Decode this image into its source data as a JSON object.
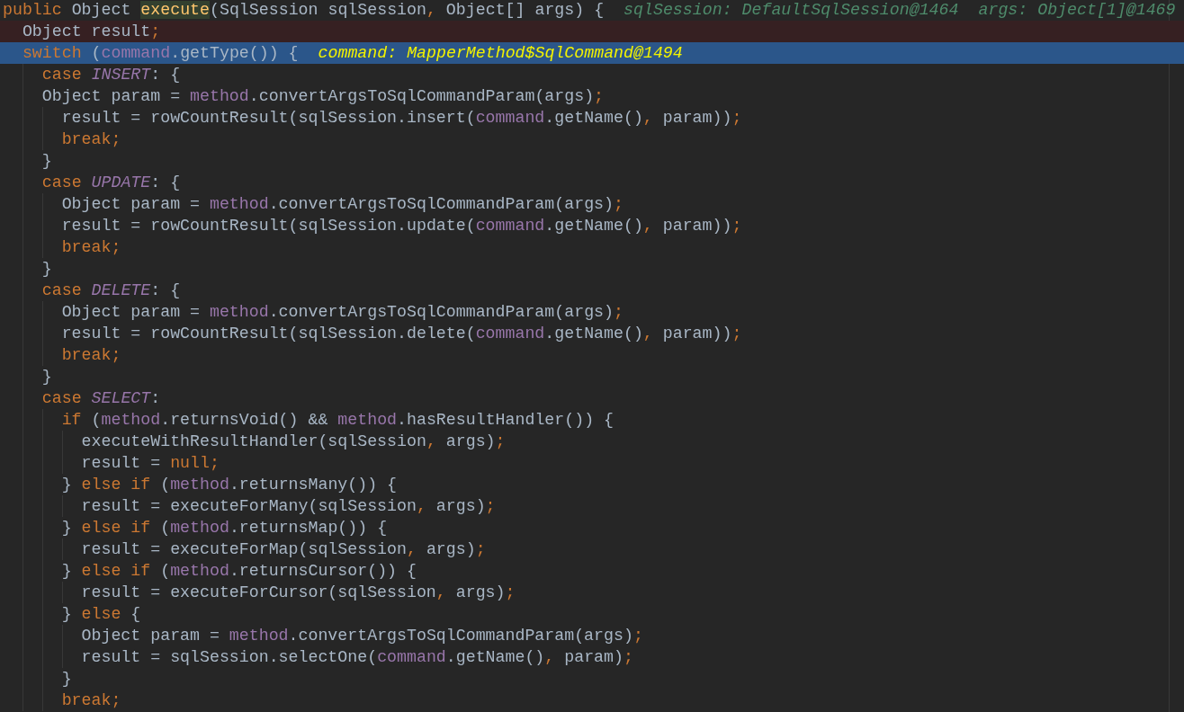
{
  "editor": {
    "lines": [
      {
        "tokens": [
          {
            "kind": "keyword",
            "text": "public"
          },
          {
            "kind": "plain",
            "text": " Object "
          },
          {
            "kind": "declaration",
            "text": "execute"
          },
          {
            "kind": "plain",
            "text": "(SqlSession sqlSession"
          },
          {
            "kind": "punctuation",
            "text": ","
          },
          {
            "kind": "plain",
            "text": " Object[] args) {"
          }
        ],
        "hints": [
          "sqlSession: DefaultSqlSession@1464",
          "args: Object[1]@1469"
        ],
        "breakpoint": false,
        "execution_point": false
      },
      {
        "tokens": [
          {
            "kind": "plain",
            "text": "  Object result"
          },
          {
            "kind": "punctuation",
            "text": ";"
          }
        ],
        "breakpoint": true,
        "execution_point": false
      },
      {
        "tokens": [
          {
            "kind": "keyword",
            "text": "  switch"
          },
          {
            "kind": "plain",
            "text": " ("
          },
          {
            "kind": "field",
            "text": "command"
          },
          {
            "kind": "plain",
            "text": ".getType()) {"
          }
        ],
        "hints": [
          "command: MapperMethod$SqlCommand@1494"
        ],
        "breakpoint": false,
        "execution_point": true
      },
      {
        "tokens": [
          {
            "kind": "keyword",
            "text": "    case "
          },
          {
            "kind": "constant",
            "text": "INSERT"
          },
          {
            "kind": "plain",
            "text": ": {"
          }
        ],
        "breakpoint": false,
        "execution_point": false
      },
      {
        "tokens": [
          {
            "kind": "plain",
            "text": "    Object param = "
          },
          {
            "kind": "field",
            "text": "method"
          },
          {
            "kind": "plain",
            "text": ".convertArgsToSqlCommandParam(args)"
          },
          {
            "kind": "punctuation",
            "text": ";"
          }
        ],
        "breakpoint": false,
        "execution_point": false
      },
      {
        "tokens": [
          {
            "kind": "plain",
            "text": "      result = rowCountResult(sqlSession.insert("
          },
          {
            "kind": "field",
            "text": "command"
          },
          {
            "kind": "plain",
            "text": ".getName()"
          },
          {
            "kind": "punctuation",
            "text": ","
          },
          {
            "kind": "plain",
            "text": " param))"
          },
          {
            "kind": "punctuation",
            "text": ";"
          }
        ],
        "breakpoint": false,
        "execution_point": false
      },
      {
        "tokens": [
          {
            "kind": "keyword",
            "text": "      break"
          },
          {
            "kind": "punctuation",
            "text": ";"
          }
        ],
        "breakpoint": false,
        "execution_point": false
      },
      {
        "tokens": [
          {
            "kind": "plain",
            "text": "    }"
          }
        ],
        "breakpoint": false,
        "execution_point": false
      },
      {
        "tokens": [
          {
            "kind": "keyword",
            "text": "    case "
          },
          {
            "kind": "constant",
            "text": "UPDATE"
          },
          {
            "kind": "plain",
            "text": ": {"
          }
        ],
        "breakpoint": false,
        "execution_point": false
      },
      {
        "tokens": [
          {
            "kind": "plain",
            "text": "      Object param = "
          },
          {
            "kind": "field",
            "text": "method"
          },
          {
            "kind": "plain",
            "text": ".convertArgsToSqlCommandParam(args)"
          },
          {
            "kind": "punctuation",
            "text": ";"
          }
        ],
        "breakpoint": false,
        "execution_point": false
      },
      {
        "tokens": [
          {
            "kind": "plain",
            "text": "      result = rowCountResult(sqlSession.update("
          },
          {
            "kind": "field",
            "text": "command"
          },
          {
            "kind": "plain",
            "text": ".getName()"
          },
          {
            "kind": "punctuation",
            "text": ","
          },
          {
            "kind": "plain",
            "text": " param))"
          },
          {
            "kind": "punctuation",
            "text": ";"
          }
        ],
        "breakpoint": false,
        "execution_point": false
      },
      {
        "tokens": [
          {
            "kind": "keyword",
            "text": "      break"
          },
          {
            "kind": "punctuation",
            "text": ";"
          }
        ],
        "breakpoint": false,
        "execution_point": false
      },
      {
        "tokens": [
          {
            "kind": "plain",
            "text": "    }"
          }
        ],
        "breakpoint": false,
        "execution_point": false
      },
      {
        "tokens": [
          {
            "kind": "keyword",
            "text": "    case "
          },
          {
            "kind": "constant",
            "text": "DELETE"
          },
          {
            "kind": "plain",
            "text": ": {"
          }
        ],
        "breakpoint": false,
        "execution_point": false
      },
      {
        "tokens": [
          {
            "kind": "plain",
            "text": "      Object param = "
          },
          {
            "kind": "field",
            "text": "method"
          },
          {
            "kind": "plain",
            "text": ".convertArgsToSqlCommandParam(args)"
          },
          {
            "kind": "punctuation",
            "text": ";"
          }
        ],
        "breakpoint": false,
        "execution_point": false
      },
      {
        "tokens": [
          {
            "kind": "plain",
            "text": "      result = rowCountResult(sqlSession.delete("
          },
          {
            "kind": "field",
            "text": "command"
          },
          {
            "kind": "plain",
            "text": ".getName()"
          },
          {
            "kind": "punctuation",
            "text": ","
          },
          {
            "kind": "plain",
            "text": " param))"
          },
          {
            "kind": "punctuation",
            "text": ";"
          }
        ],
        "breakpoint": false,
        "execution_point": false
      },
      {
        "tokens": [
          {
            "kind": "keyword",
            "text": "      break"
          },
          {
            "kind": "punctuation",
            "text": ";"
          }
        ],
        "breakpoint": false,
        "execution_point": false
      },
      {
        "tokens": [
          {
            "kind": "plain",
            "text": "    }"
          }
        ],
        "breakpoint": false,
        "execution_point": false
      },
      {
        "tokens": [
          {
            "kind": "keyword",
            "text": "    case "
          },
          {
            "kind": "constant",
            "text": "SELECT"
          },
          {
            "kind": "plain",
            "text": ":"
          }
        ],
        "breakpoint": false,
        "execution_point": false
      },
      {
        "tokens": [
          {
            "kind": "keyword",
            "text": "      if"
          },
          {
            "kind": "plain",
            "text": " ("
          },
          {
            "kind": "field",
            "text": "method"
          },
          {
            "kind": "plain",
            "text": ".returnsVoid() && "
          },
          {
            "kind": "field",
            "text": "method"
          },
          {
            "kind": "plain",
            "text": ".hasResultHandler()) {"
          }
        ],
        "breakpoint": false,
        "execution_point": false
      },
      {
        "tokens": [
          {
            "kind": "plain",
            "text": "        executeWithResultHandler(sqlSession"
          },
          {
            "kind": "punctuation",
            "text": ","
          },
          {
            "kind": "plain",
            "text": " args)"
          },
          {
            "kind": "punctuation",
            "text": ";"
          }
        ],
        "breakpoint": false,
        "execution_point": false
      },
      {
        "tokens": [
          {
            "kind": "plain",
            "text": "        result = "
          },
          {
            "kind": "keyword",
            "text": "null"
          },
          {
            "kind": "punctuation",
            "text": ";"
          }
        ],
        "breakpoint": false,
        "execution_point": false
      },
      {
        "tokens": [
          {
            "kind": "plain",
            "text": "      } "
          },
          {
            "kind": "keyword",
            "text": "else if"
          },
          {
            "kind": "plain",
            "text": " ("
          },
          {
            "kind": "field",
            "text": "method"
          },
          {
            "kind": "plain",
            "text": ".returnsMany()) {"
          }
        ],
        "breakpoint": false,
        "execution_point": false
      },
      {
        "tokens": [
          {
            "kind": "plain",
            "text": "        result = executeForMany(sqlSession"
          },
          {
            "kind": "punctuation",
            "text": ","
          },
          {
            "kind": "plain",
            "text": " args)"
          },
          {
            "kind": "punctuation",
            "text": ";"
          }
        ],
        "breakpoint": false,
        "execution_point": false
      },
      {
        "tokens": [
          {
            "kind": "plain",
            "text": "      } "
          },
          {
            "kind": "keyword",
            "text": "else if"
          },
          {
            "kind": "plain",
            "text": " ("
          },
          {
            "kind": "field",
            "text": "method"
          },
          {
            "kind": "plain",
            "text": ".returnsMap()) {"
          }
        ],
        "breakpoint": false,
        "execution_point": false
      },
      {
        "tokens": [
          {
            "kind": "plain",
            "text": "        result = executeForMap(sqlSession"
          },
          {
            "kind": "punctuation",
            "text": ","
          },
          {
            "kind": "plain",
            "text": " args)"
          },
          {
            "kind": "punctuation",
            "text": ";"
          }
        ],
        "breakpoint": false,
        "execution_point": false
      },
      {
        "tokens": [
          {
            "kind": "plain",
            "text": "      } "
          },
          {
            "kind": "keyword",
            "text": "else if"
          },
          {
            "kind": "plain",
            "text": " ("
          },
          {
            "kind": "field",
            "text": "method"
          },
          {
            "kind": "plain",
            "text": ".returnsCursor()) {"
          }
        ],
        "breakpoint": false,
        "execution_point": false
      },
      {
        "tokens": [
          {
            "kind": "plain",
            "text": "        result = executeForCursor(sqlSession"
          },
          {
            "kind": "punctuation",
            "text": ","
          },
          {
            "kind": "plain",
            "text": " args)"
          },
          {
            "kind": "punctuation",
            "text": ";"
          }
        ],
        "breakpoint": false,
        "execution_point": false
      },
      {
        "tokens": [
          {
            "kind": "plain",
            "text": "      } "
          },
          {
            "kind": "keyword",
            "text": "else"
          },
          {
            "kind": "plain",
            "text": " {"
          }
        ],
        "breakpoint": false,
        "execution_point": false
      },
      {
        "tokens": [
          {
            "kind": "plain",
            "text": "        Object param = "
          },
          {
            "kind": "field",
            "text": "method"
          },
          {
            "kind": "plain",
            "text": ".convertArgsToSqlCommandParam(args)"
          },
          {
            "kind": "punctuation",
            "text": ";"
          }
        ],
        "breakpoint": false,
        "execution_point": false
      },
      {
        "tokens": [
          {
            "kind": "plain",
            "text": "        result = sqlSession.selectOne("
          },
          {
            "kind": "field",
            "text": "command"
          },
          {
            "kind": "plain",
            "text": ".getName()"
          },
          {
            "kind": "punctuation",
            "text": ","
          },
          {
            "kind": "plain",
            "text": " param)"
          },
          {
            "kind": "punctuation",
            "text": ";"
          }
        ],
        "breakpoint": false,
        "execution_point": false
      },
      {
        "tokens": [
          {
            "kind": "plain",
            "text": "      }"
          }
        ],
        "breakpoint": false,
        "execution_point": false
      },
      {
        "tokens": [
          {
            "kind": "keyword",
            "text": "      break"
          },
          {
            "kind": "punctuation",
            "text": ";"
          }
        ],
        "breakpoint": false,
        "execution_point": false
      }
    ]
  }
}
